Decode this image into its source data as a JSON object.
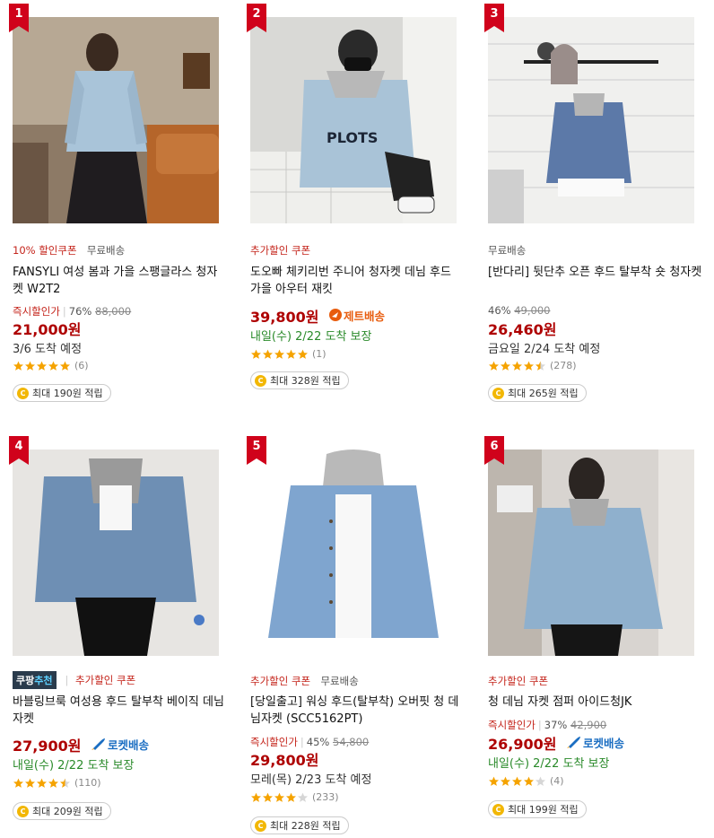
{
  "colors": {
    "price": "#ae0000",
    "rank_badge": "#d0021b",
    "green": "#2a8a2a",
    "rocket": "#1b6ec2",
    "jet": "#e85c0d"
  },
  "products": [
    {
      "rank": "1",
      "coupon1": "10% 할인쿠폰",
      "coupon2": "무료배송",
      "title": "FANSYLI 여성 봄과 가을 스팽글라스 청자켓 W2T2",
      "discount_label": "즉시할인가",
      "discount_pct": "76%",
      "original_price": "88,000",
      "price": "21,000원",
      "ship_badge": "",
      "delivery": "3/6 도착 예정",
      "rating": 5,
      "review_count": "(6)",
      "reward": "최대 190원 적립"
    },
    {
      "rank": "2",
      "coupon1": "추가할인 쿠폰",
      "coupon2": "",
      "title": "도오빠 체키리번 주니어 청자켓 데님 후드 가을 아우터 재킷",
      "discount_label": "",
      "discount_pct": "",
      "original_price": "",
      "price": "39,800원",
      "ship_badge": "제트배송",
      "delivery": "내일(수) 2/22 도착 보장",
      "rating": 5,
      "review_count": "(1)",
      "reward": "최대 328원 적립"
    },
    {
      "rank": "3",
      "coupon1": "",
      "coupon2": "무료배송",
      "title": "[반다리] 뒷단추 오픈 후드 탈부착 숏 청자켓",
      "discount_label": "",
      "discount_pct": "46%",
      "original_price": "49,000",
      "price": "26,460원",
      "ship_badge": "",
      "delivery": "금요일 2/24 도착 예정",
      "rating": 4.5,
      "review_count": "(278)",
      "reward": "최대 265원 적립"
    },
    {
      "rank": "4",
      "recommend_a": "쿠팡",
      "recommend_b": "추천",
      "coupon1": "추가할인 쿠폰",
      "coupon2": "",
      "title": "바블링브룩 여성용 후드 탈부착 베이직 데님 자켓",
      "discount_label": "",
      "discount_pct": "",
      "original_price": "",
      "price": "27,900원",
      "ship_badge": "로켓배송",
      "delivery": "내일(수) 2/22 도착 보장",
      "rating": 4.5,
      "review_count": "(110)",
      "reward": "최대 209원 적립"
    },
    {
      "rank": "5",
      "coupon1": "추가할인 쿠폰",
      "coupon2": "무료배송",
      "title": "[당일출고] 워싱 후드(탈부착) 오버핏 청 데님자켓 (SCC5162PT)",
      "discount_label": "즉시할인가",
      "discount_pct": "45%",
      "original_price": "54,800",
      "price": "29,800원",
      "ship_badge": "",
      "delivery": "모레(목) 2/23 도착 예정",
      "rating": 4,
      "review_count": "(233)",
      "reward": "최대 228원 적립"
    },
    {
      "rank": "6",
      "coupon1": "추가할인 쿠폰",
      "coupon2": "",
      "title": "청 데님 자켓 점퍼 아이드청JK",
      "discount_label": "즉시할인가",
      "discount_pct": "37%",
      "original_price": "42,900",
      "price": "26,900원",
      "ship_badge": "로켓배송",
      "delivery": "내일(수) 2/22 도착 보장",
      "rating": 4,
      "review_count": "(4)",
      "reward": "최대 199원 적립"
    }
  ]
}
